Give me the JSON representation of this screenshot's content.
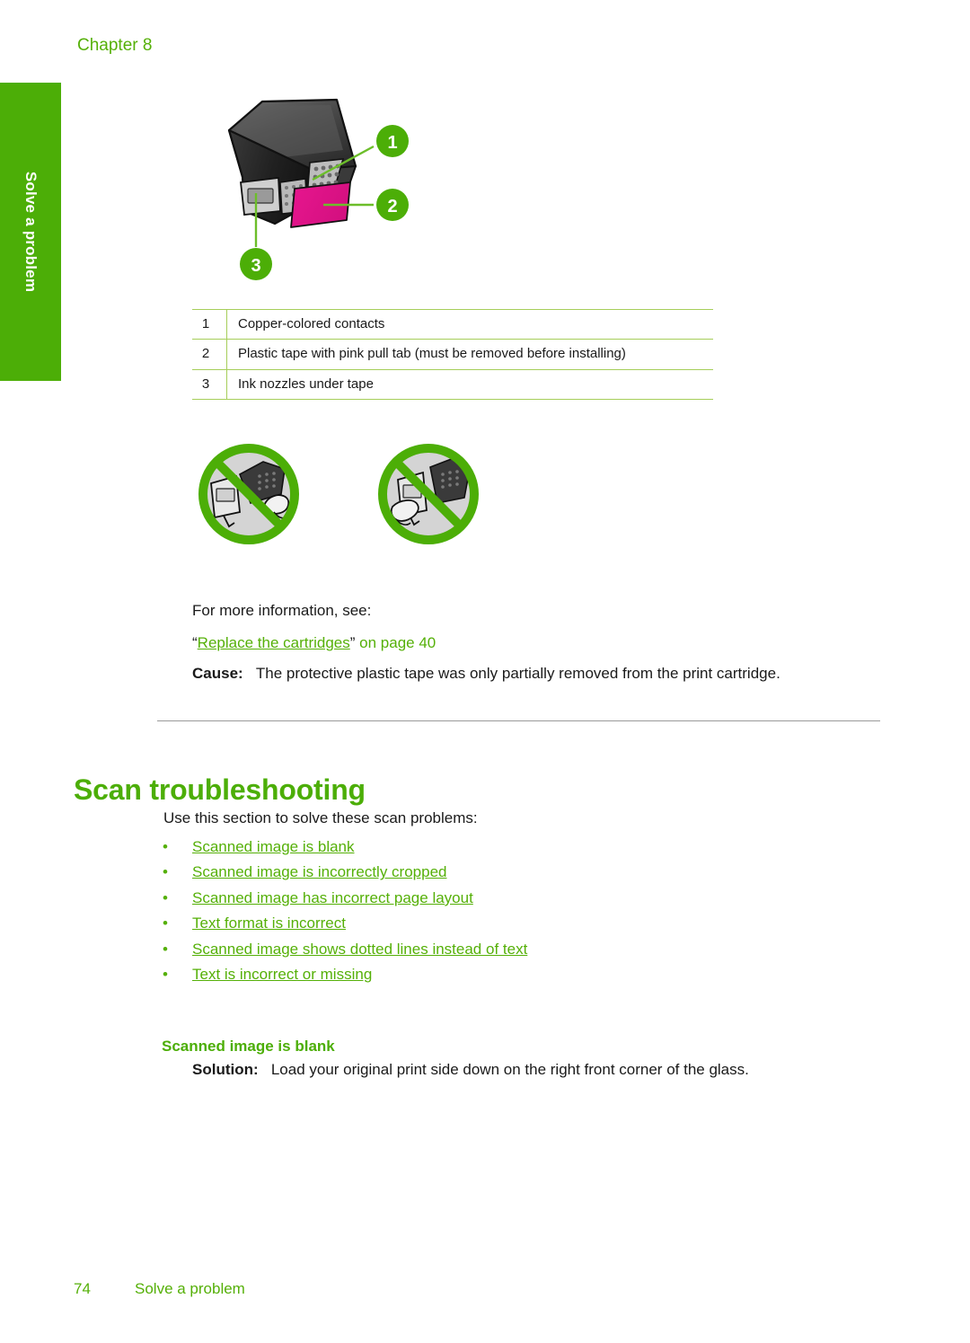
{
  "page": {
    "chapter_header": "Chapter 8",
    "side_tab_label": "Solve a problem",
    "page_number": "74",
    "footer_section": "Solve a problem",
    "accent_green": "#4CAE07",
    "link_green": "#55B008",
    "table_border_green": "#A6CE5A",
    "tape_magenta": "#E8168F",
    "divider_gray": "#9a9a9a"
  },
  "cartridge_figure": {
    "alt": "print cartridge with numbered callouts",
    "callouts": [
      "1",
      "2",
      "3"
    ]
  },
  "callout_table": {
    "rows": [
      {
        "num": "1",
        "desc": "Copper-colored contacts"
      },
      {
        "num": "2",
        "desc": "Plastic tape with pink pull tab (must be removed before installing)"
      },
      {
        "num": "3",
        "desc": "Ink nozzles under tape"
      }
    ]
  },
  "prohibit_figure": {
    "alt": "two prohibition symbols showing do-not-touch contacts and do-not-touch nozzles"
  },
  "more_info": {
    "intro": "For more information, see:",
    "link_open_quote": "“",
    "link_text": "Replace the cartridges",
    "link_close_quote": "”",
    "link_suffix": " on page 40"
  },
  "cause": {
    "label": "Cause:",
    "text": "The protective plastic tape was only partially removed from the print cartridge."
  },
  "scan_section": {
    "heading": "Scan troubleshooting",
    "intro": "Use this section to solve these scan problems:",
    "bullets": [
      "Scanned image is blank",
      "Scanned image is incorrectly cropped",
      "Scanned image has incorrect page layout",
      "Text format is incorrect",
      "Scanned image shows dotted lines instead of text",
      "Text is incorrect or missing"
    ],
    "sub_heading": "Scanned image is blank",
    "solution_label": "Solution:",
    "solution_text": "Load your original print side down on the right front corner of the glass."
  }
}
